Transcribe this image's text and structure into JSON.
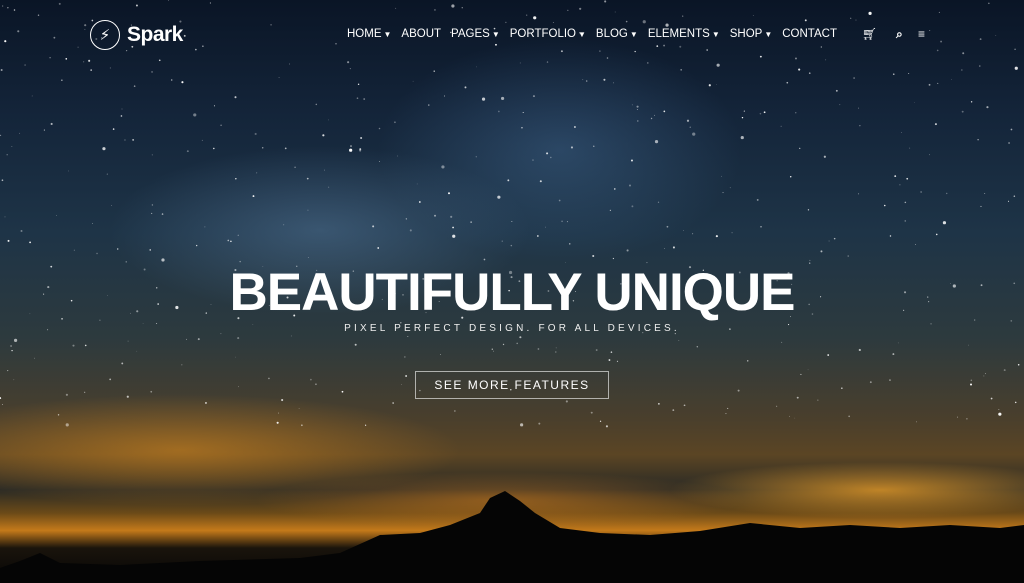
{
  "header": {
    "logo_text": "Spark",
    "nav": [
      {
        "label": "HOME",
        "dropdown": true
      },
      {
        "label": "ABOUT",
        "dropdown": false
      },
      {
        "label": "PAGES",
        "dropdown": true
      },
      {
        "label": "PORTFOLIO",
        "dropdown": true
      },
      {
        "label": "BLOG",
        "dropdown": true
      },
      {
        "label": "ELEMENTS",
        "dropdown": true
      },
      {
        "label": "SHOP",
        "dropdown": true
      },
      {
        "label": "CONTACT",
        "dropdown": false
      }
    ],
    "icons": [
      "cart-icon",
      "search-icon",
      "menu-icon"
    ]
  },
  "hero": {
    "title": "BEAUTIFULLY UNIQUE",
    "subtitle": "PIXEL PERFECT DESIGN. FOR ALL DEVICES.",
    "button_label": "SEE MORE FEATURES"
  }
}
